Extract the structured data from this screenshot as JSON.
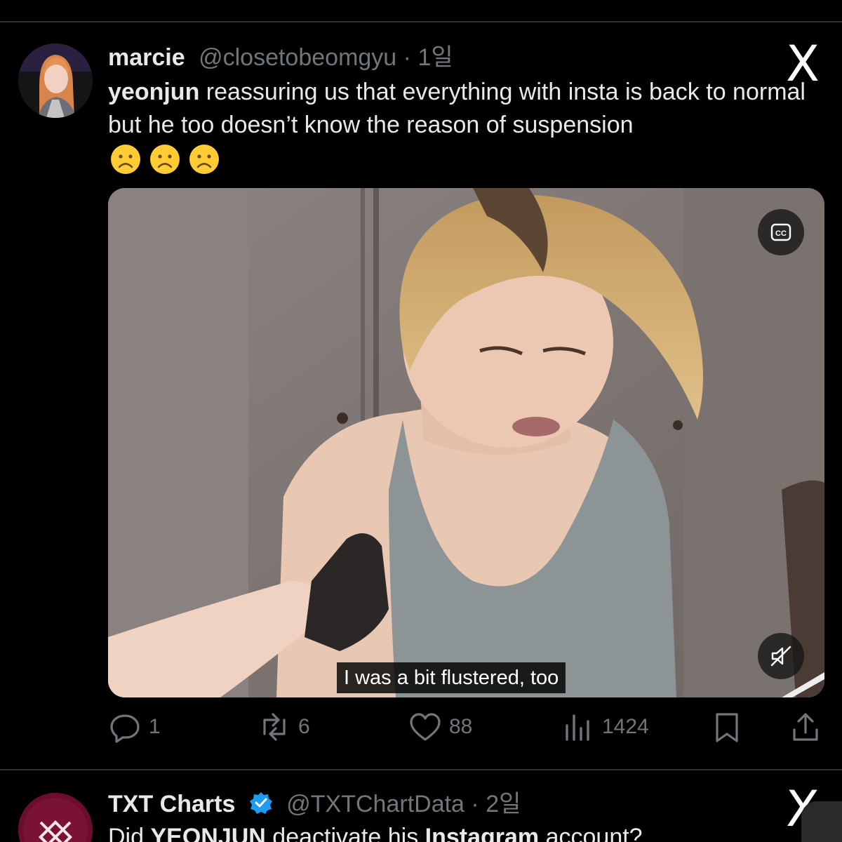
{
  "tweets": [
    {
      "display_name": "marcie",
      "handle": "@closetobeomgyu",
      "separator": "·",
      "age": "1일",
      "body_bold": "yeonjun",
      "body_rest": " reassuring us that everything with insta is back to normal but he too doesn’t know the reason of suspension",
      "emoji": [
        "frowning-face",
        "frowning-face",
        "frowning-face"
      ],
      "media": {
        "subtitle": "I was a bit flustered, too",
        "cc_label": "CC"
      },
      "stats": {
        "replies": "1",
        "retweets": "6",
        "likes": "88",
        "views": "1424"
      }
    },
    {
      "display_name": "TXT Charts",
      "handle": "@TXTChartData",
      "separator": "·",
      "age": "2일",
      "verified": true,
      "body_pre": "Did ",
      "body_bold_1": "YEONJUN",
      "body_mid": " deactivate his ",
      "body_bold_2": "Instagram",
      "body_post": " account?"
    }
  ],
  "brand": {
    "logo": "X",
    "accent": "#1d9bf0",
    "background": "#000000",
    "secondary_text": "#71767b"
  },
  "icons": [
    "x-logo-icon",
    "cc-icon",
    "mute-icon",
    "reply-icon",
    "retweet-icon",
    "like-icon",
    "views-icon",
    "bookmark-icon",
    "share-icon",
    "verified-icon"
  ]
}
